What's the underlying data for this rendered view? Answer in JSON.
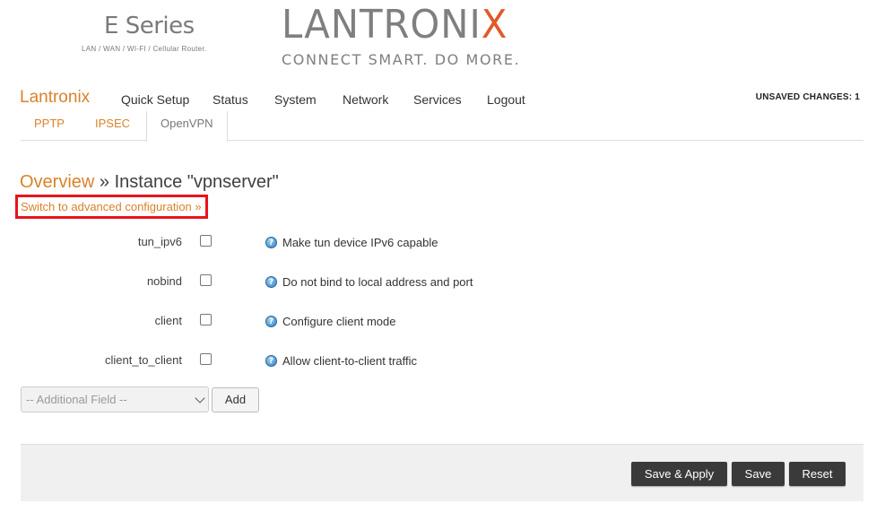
{
  "header": {
    "series_title": "E Series",
    "series_subtitle": "LAN / WAN / WI-FI / Cellular Router.",
    "logo_main": "LANTRONI",
    "logo_x": "X",
    "logo_tagline": "CONNECT SMART. DO MORE.",
    "logo_accent_color": "#e05a2b"
  },
  "navbar": {
    "brand": "Lantronix",
    "items": [
      {
        "label": "Quick Setup"
      },
      {
        "label": "Status"
      },
      {
        "label": "System"
      },
      {
        "label": "Network"
      },
      {
        "label": "Services"
      },
      {
        "label": "Logout"
      }
    ],
    "unsaved": "UNSAVED CHANGES: 1"
  },
  "subtabs": [
    {
      "label": "PPTP",
      "active": false
    },
    {
      "label": "IPSEC",
      "active": false
    },
    {
      "label": "OpenVPN",
      "active": true
    }
  ],
  "page": {
    "breadcrumb_link": "Overview",
    "breadcrumb_separator": " » ",
    "title": "Instance \"vpnserver\"",
    "advanced_link": "Switch to advanced configuration »"
  },
  "options": [
    {
      "label": "tun_ipv6",
      "checked": false,
      "description": "Make tun device IPv6 capable",
      "help_icon": "help-icon"
    },
    {
      "label": "nobind",
      "checked": false,
      "description": "Do not bind to local address and port",
      "help_icon": "help-icon"
    },
    {
      "label": "client",
      "checked": false,
      "description": "Configure client mode",
      "help_icon": "help-icon"
    },
    {
      "label": "client_to_client",
      "checked": false,
      "description": "Allow client-to-client traffic",
      "help_icon": "help-icon"
    }
  ],
  "additional_field": {
    "selected": "-- Additional Field --",
    "add_label": "Add"
  },
  "footer": {
    "save_apply": "Save & Apply",
    "save": "Save",
    "reset": "Reset"
  },
  "colors": {
    "accent_orange": "#d9822b",
    "highlight_red": "#e8141b",
    "button_dark": "#3a3a3a"
  }
}
